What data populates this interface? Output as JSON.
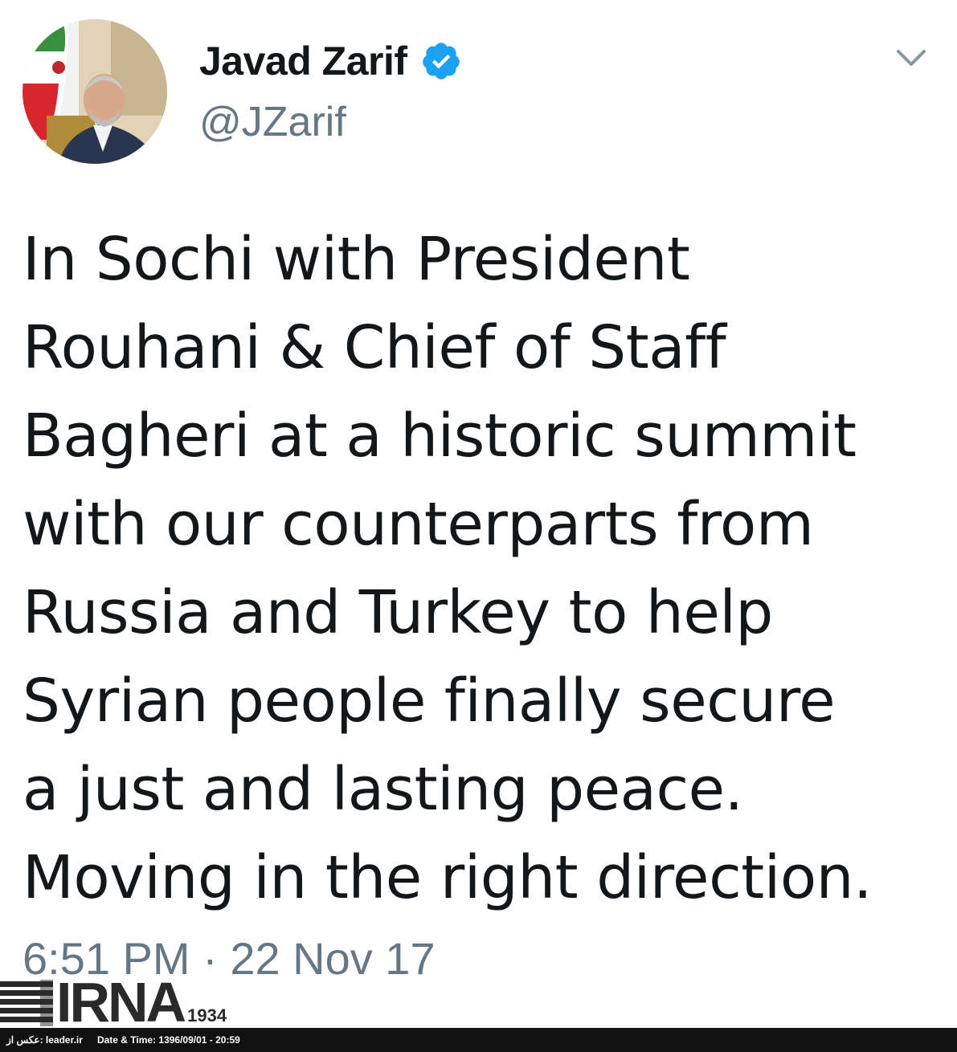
{
  "tweet": {
    "author": {
      "display_name": "Javad Zarif",
      "handle": "@JZarif",
      "verified": true
    },
    "text": "In Sochi with President\nRouhani & Chief of Staff\nBagheri at a historic summit\nwith our counterparts from\nRussia and Turkey to help\nSyrian people finally secure\na just and lasting peace.\nMoving in the right direction.",
    "timestamp": "6:51 PM · 22 Nov 17"
  },
  "icons": {
    "verified": "verified-badge-icon",
    "menu": "chevron-down-icon"
  },
  "colors": {
    "verified_blue": "#1da1f2",
    "text_primary": "#14171a",
    "text_secondary": "#657786"
  },
  "watermark": {
    "logo_text": "IRNA",
    "logo_year": "1934",
    "source": "عکس از: leader.ir",
    "date_time": "Date & Time: 1396/09/01 - 20:59"
  }
}
